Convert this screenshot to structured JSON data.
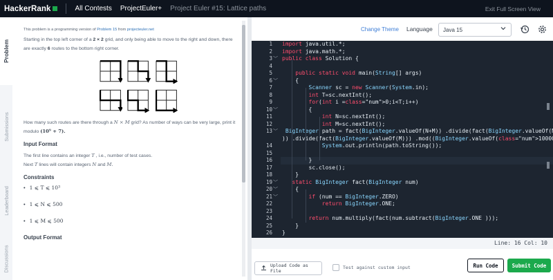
{
  "nav": {
    "logo": "HackerRank",
    "all_contests": "All Contests",
    "contest": "ProjectEuler+",
    "problem": "Project Euler #15: Lattice paths",
    "exit": "Exit Full Screen View"
  },
  "tabs": [
    "Problem",
    "Submissions",
    "Leaderboard",
    "Discussions"
  ],
  "problem": {
    "note_prefix": "This problem is a programming version of",
    "note_link": "Problem 15",
    "note_mid": "from",
    "note_link2": "projecteuler.net",
    "intro_a": "Starting in the top left corner of a",
    "intro_grid": "2 × 2",
    "intro_b": "grid, and only being able to move to the right and down, there are exactly",
    "intro_count": "6",
    "intro_c": "routes to the bottom right corner.",
    "question_a": "How many such routes are there through a",
    "question_grid": "N × M",
    "question_b": "grid? As number of ways can be very large, print it modulo",
    "question_mod": "(10⁹ + 7).",
    "input_title": "Input Format",
    "input_line1_a": "The first line contains an integer",
    "input_line1_var": "T",
    "input_line1_b": ", i.e., number of test cases.",
    "input_line2_a": "Next",
    "input_line2_var": "T",
    "input_line2_b": "lines will contain integers",
    "input_line2_n": "N",
    "input_line2_and": "and",
    "input_line2_m": "M.",
    "constraints_title": "Constraints",
    "constraints": [
      "1 ⩽ T ⩽ 10³",
      "1 ⩽ N ⩽ 500",
      "1 ⩽ M ⩽ 500"
    ],
    "output_title": "Output Format"
  },
  "editor": {
    "change_theme": "Change Theme",
    "language_label": "Language",
    "language": "Java 15",
    "status": "Line: 16  Col: 10",
    "upload": "Upload Code as File",
    "custom_input": "Test against custom input",
    "run": "Run Code",
    "submit": "Submit Code"
  },
  "icons": {
    "reset": "history-icon",
    "settings": "gear-icon",
    "upload": "upload-icon",
    "dropdown": "chevron-down-icon"
  },
  "colors": {
    "nav_bg": "#0e141e",
    "brand_green": "#1ba94c",
    "editor_bg": "#1d2530",
    "keyword": "#ff4d6d",
    "type": "#8ad7ff",
    "accent_link": "#3e7ed6"
  },
  "code_lines": [
    {
      "n": "1",
      "f": "",
      "t": "import java.util.*;"
    },
    {
      "n": "2",
      "f": "",
      "t": "import java.math.*;"
    },
    {
      "n": "3",
      "f": "﹀",
      "t": "public class Solution {"
    },
    {
      "n": "4",
      "f": "",
      "t": ""
    },
    {
      "n": "5",
      "f": "",
      "t": "    public static void main(String[] args)"
    },
    {
      "n": "6",
      "f": "﹀",
      "t": "    {"
    },
    {
      "n": "7",
      "f": "",
      "t": "        Scanner sc = new Scanner(System.in);"
    },
    {
      "n": "8",
      "f": "",
      "t": "        int T=sc.nextInt();"
    },
    {
      "n": "9",
      "f": "",
      "t": "        for(int i =0;i<T;i++)"
    },
    {
      "n": "10",
      "f": "﹀",
      "t": "        {"
    },
    {
      "n": "11",
      "f": "",
      "t": "            int N=sc.nextInt();"
    },
    {
      "n": "12",
      "f": "",
      "t": "            int M=sc.nextInt();"
    },
    {
      "n": "13",
      "f": "﹀",
      "t": " BigInteger path = fact(BigInteger.valueOf(N+M)) .divide(fact(BigInteger.valueOf(N"
    },
    {
      "n": "",
      "f": "",
      "t": ")) .divide(fact(BigInteger.valueOf(M))) .mod((BigInteger.valueOf(1000000007)));"
    },
    {
      "n": "14",
      "f": "",
      "t": "            System.out.println(path.toString());"
    },
    {
      "n": "15",
      "f": "",
      "t": ""
    },
    {
      "n": "16",
      "f": "",
      "t": "        }"
    },
    {
      "n": "17",
      "f": "",
      "t": "        sc.close();"
    },
    {
      "n": "18",
      "f": "",
      "t": "    }"
    },
    {
      "n": "19",
      "f": "﹀",
      "t": "   static BigInteger fact(BigInteger num)"
    },
    {
      "n": "20",
      "f": "﹀",
      "t": "    {"
    },
    {
      "n": "21",
      "f": "﹀",
      "t": "        if (num == BigInteger.ZERO)"
    },
    {
      "n": "22",
      "f": "",
      "t": "            return BigInteger.ONE;"
    },
    {
      "n": "23",
      "f": "",
      "t": ""
    },
    {
      "n": "24",
      "f": "",
      "t": "        return num.multiply(fact(num.subtract(BigInteger.ONE )));"
    },
    {
      "n": "25",
      "f": "",
      "t": "    }"
    },
    {
      "n": "26",
      "f": "",
      "t": "}"
    }
  ]
}
